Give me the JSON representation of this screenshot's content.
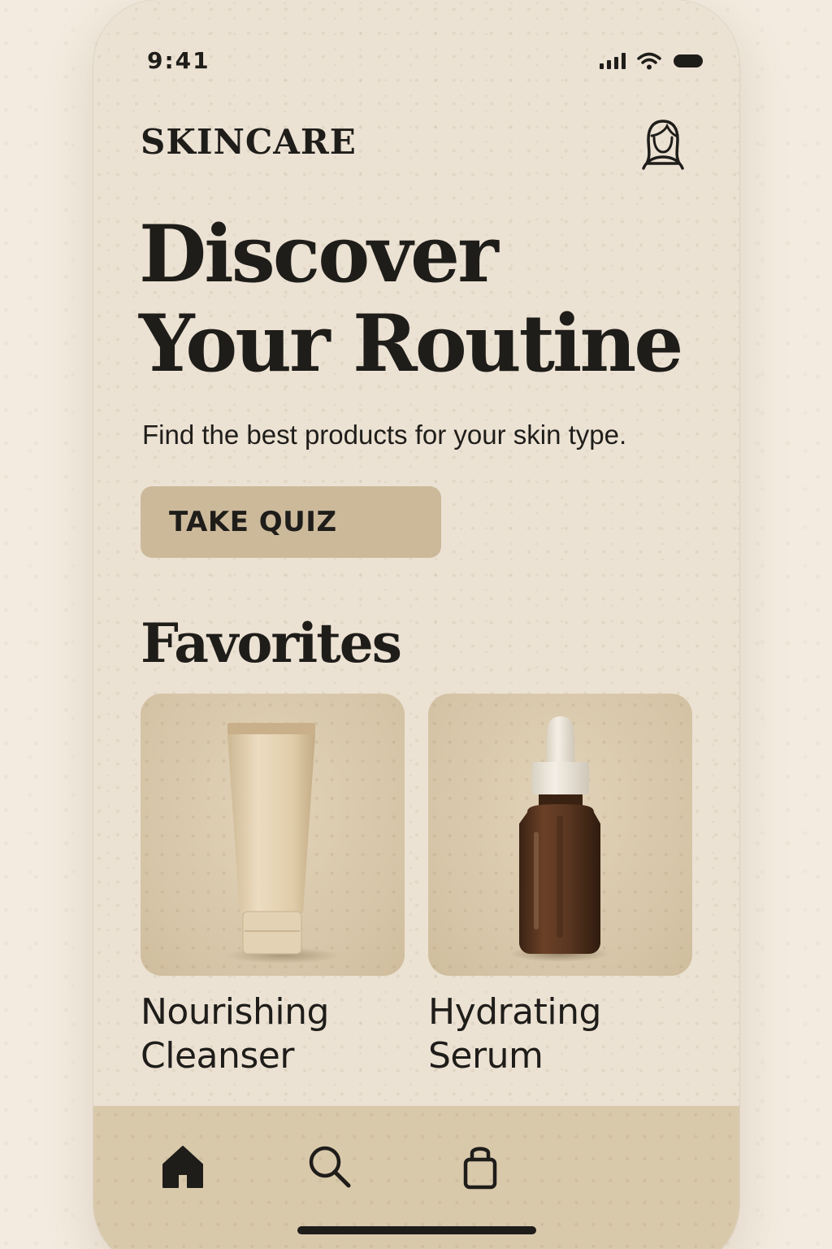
{
  "status_bar": {
    "time": "9:41",
    "icons": [
      "signal-icon",
      "wifi-icon",
      "battery-icon"
    ]
  },
  "header": {
    "brand": "SKINCARE",
    "profile_icon": "profile-icon"
  },
  "hero": {
    "title_line1": "Discover",
    "title_line2": "Your Routine",
    "subtitle": "Find the best products for your skin type.",
    "cta_label": "TAKE QUIZ"
  },
  "favorites": {
    "title": "Favorites",
    "products": [
      {
        "name_line1": "Nourishing",
        "name_line2": "Cleanser",
        "image": "cleanser-tube"
      },
      {
        "name_line1": "Hydrating",
        "name_line2": "Serum",
        "image": "serum-dropper-bottle"
      }
    ]
  },
  "bottom_nav": {
    "items": [
      {
        "icon": "home-icon",
        "active": true
      },
      {
        "icon": "search-icon",
        "active": false
      },
      {
        "icon": "bag-icon",
        "active": false
      }
    ]
  },
  "colors": {
    "background": "#f3ebdf",
    "phone": "#ece2d3",
    "button": "#cbb99a",
    "nav": "#d9c9ab",
    "text": "#1f1d1a",
    "serum_amber": "#5a3620"
  }
}
